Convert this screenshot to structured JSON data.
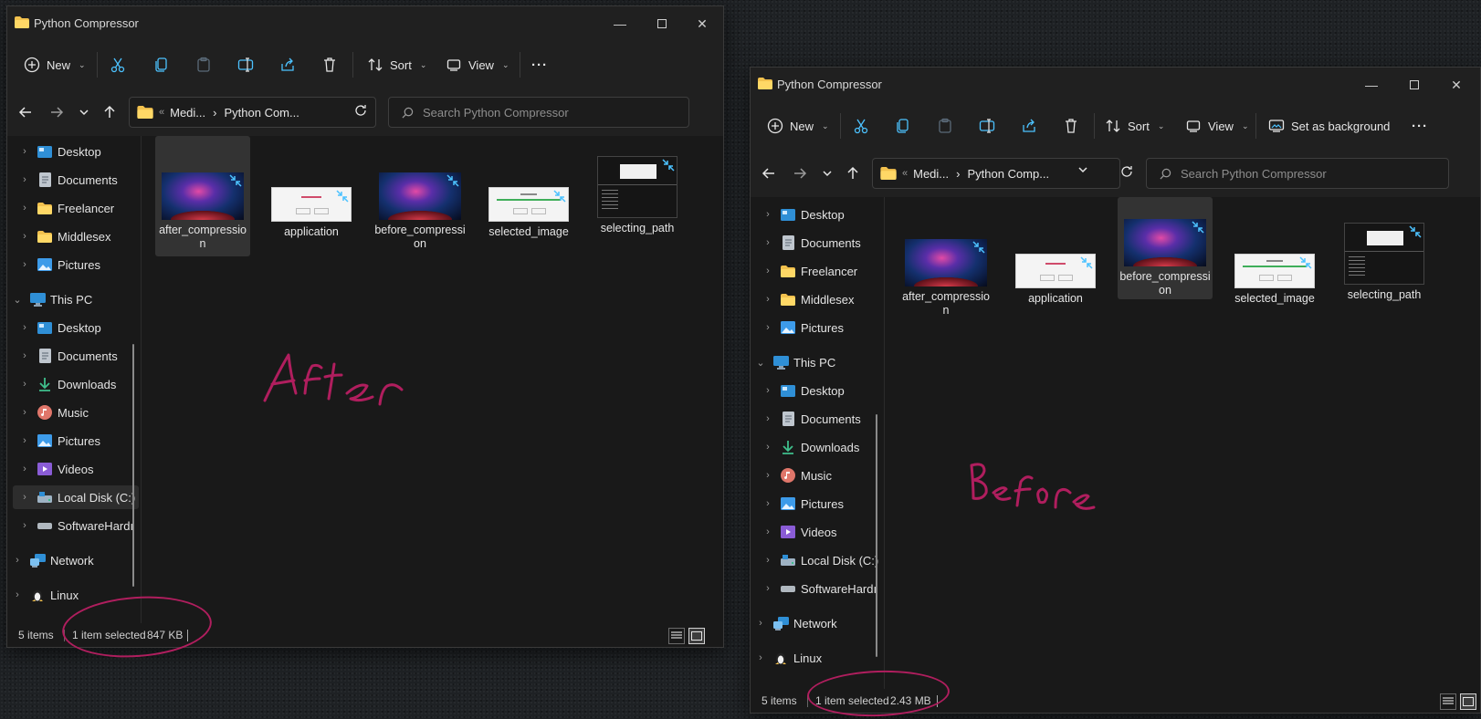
{
  "windows": [
    {
      "title": "Python Compressor",
      "toolbar": {
        "new_label": "New",
        "sort_label": "Sort",
        "view_label": "View",
        "set_bg_label": "",
        "more_label": "···"
      },
      "address": {
        "prefix": "«",
        "crumb1": "Medi...",
        "sep": "›",
        "crumb2": "Python Com..."
      },
      "search_placeholder": "Search Python Compressor",
      "sidebar": {
        "quick": [
          "Desktop",
          "Documents",
          "Freelancer",
          "Middlesex",
          "Pictures"
        ],
        "this_pc": "This PC",
        "pc_items": [
          "Desktop",
          "Documents",
          "Downloads",
          "Music",
          "Pictures",
          "Videos",
          "Local Disk (C:)",
          "SoftwareHardı"
        ],
        "network": "Network",
        "linux": "Linux"
      },
      "files": [
        "after_compression",
        "application",
        "before_compression",
        "selected_image",
        "selecting_path"
      ],
      "selected_index": 0,
      "status": {
        "items": "5 items",
        "selected": "1 item selected",
        "size": "847 KB"
      },
      "annotation": "After"
    },
    {
      "title": "Python Compressor",
      "toolbar": {
        "new_label": "New",
        "sort_label": "Sort",
        "view_label": "View",
        "set_bg_label": "Set as background",
        "more_label": "···"
      },
      "address": {
        "prefix": "«",
        "crumb1": "Medi...",
        "sep": "›",
        "crumb2": "Python Comp..."
      },
      "search_placeholder": "Search Python Compressor",
      "sidebar": {
        "quick": [
          "Desktop",
          "Documents",
          "Freelancer",
          "Middlesex",
          "Pictures"
        ],
        "this_pc": "This PC",
        "pc_items": [
          "Desktop",
          "Documents",
          "Downloads",
          "Music",
          "Pictures",
          "Videos",
          "Local Disk (C:)",
          "SoftwareHardı"
        ],
        "network": "Network",
        "linux": "Linux"
      },
      "files": [
        "after_compression",
        "application",
        "before_compression",
        "selected_image",
        "selecting_path"
      ],
      "selected_index": 2,
      "status": {
        "items": "5 items",
        "selected": "1 item selected",
        "size": "2.43 MB"
      },
      "annotation": "Before"
    }
  ],
  "colors": {
    "annotation": "#b01e5e",
    "folder": "#f2c14e",
    "accent": "#4cc2ff"
  }
}
